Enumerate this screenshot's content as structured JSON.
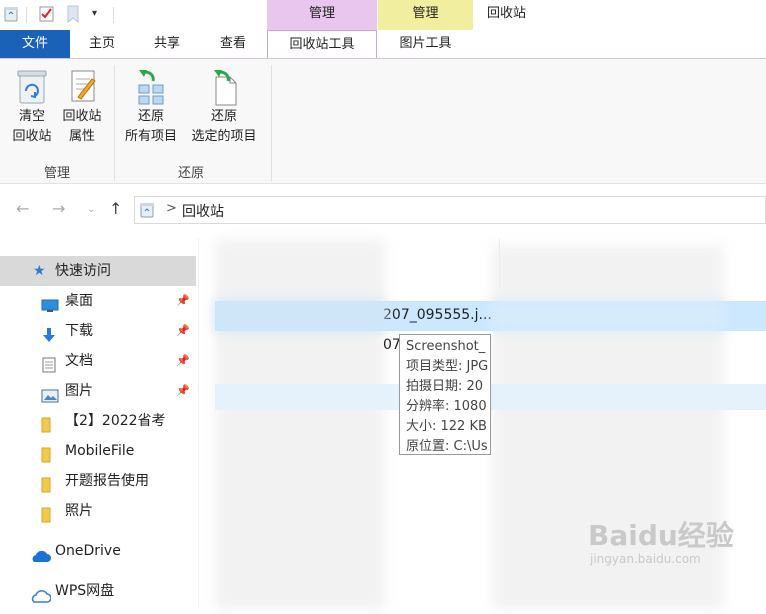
{
  "window": {
    "title": "回收站",
    "context_tabs": [
      "管理",
      "管理"
    ]
  },
  "ribbon_tabs": [
    "文件",
    "主页",
    "共享",
    "查看",
    "回收站工具",
    "图片工具"
  ],
  "ribbon": {
    "groups": [
      {
        "label": "管理",
        "buttons": [
          {
            "line1": "清空",
            "line2": "回收站",
            "icon": "empty-recycle-bin-icon"
          },
          {
            "line1": "回收站",
            "line2": "属性",
            "icon": "recycle-bin-properties-icon"
          }
        ]
      },
      {
        "label": "还原",
        "buttons": [
          {
            "line1": "还原",
            "line2": "所有项目",
            "icon": "restore-all-icon"
          },
          {
            "line1": "还原",
            "line2": "选定的项目",
            "icon": "restore-selected-icon"
          }
        ]
      }
    ]
  },
  "address": {
    "path": "回收站",
    "separator": ">"
  },
  "nav_pane": {
    "items": [
      {
        "label": "快速访问",
        "icon": "star-icon",
        "selected": true
      },
      {
        "label": "桌面",
        "icon": "desktop-icon",
        "pinned": true
      },
      {
        "label": "下载",
        "icon": "download-icon",
        "pinned": true
      },
      {
        "label": "文档",
        "icon": "document-icon",
        "pinned": true
      },
      {
        "label": "图片",
        "icon": "pictures-icon",
        "pinned": true
      },
      {
        "label": "【2】2022省考",
        "icon": "folder-icon"
      },
      {
        "label": "MobileFile",
        "icon": "folder-icon"
      },
      {
        "label": "开题报告使用",
        "icon": "folder-icon"
      },
      {
        "label": "照片",
        "icon": "folder-icon"
      },
      {
        "label": "OneDrive",
        "icon": "cloud-icon"
      },
      {
        "label": "WPS网盘",
        "icon": "wps-cloud-icon"
      }
    ]
  },
  "file_list": {
    "row1_name_fragment": "207_095555.j...",
    "row2_name_fragment": "07"
  },
  "tooltip": {
    "lines": [
      "Screenshot_",
      "项目类型: JPG",
      "拍摄日期: 20",
      "分辨率: 1080",
      "大小: 122 KB",
      "原位置: C:\\Us"
    ]
  },
  "watermark": {
    "brand": "Baidu经验",
    "url": "jingyan.baidu.com"
  },
  "colors": {
    "file_tab": "#1a62b8",
    "context_manage_recycle": "#e8c6ee",
    "context_manage_picture": "#f2eea0",
    "selected_row": "#cce8ff",
    "nav_selected": "#d9d9d9"
  }
}
